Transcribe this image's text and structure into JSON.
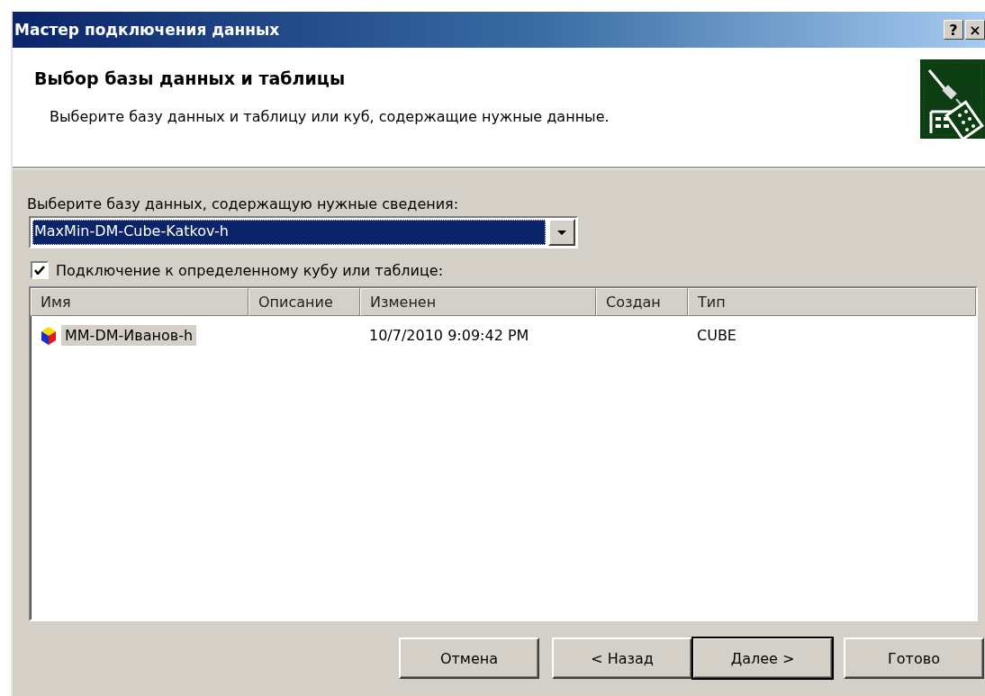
{
  "window": {
    "title": "Мастер подключения данных",
    "controls": [
      "?",
      "×"
    ]
  },
  "header": {
    "title": "Выбор базы данных и таблицы",
    "subtitle": "Выберите базу данных и таблицу или куб, содержащие нужные данные."
  },
  "database": {
    "label": "Выберите базу данных, содержащую нужные сведения:",
    "value": "MaxMin-DM-Cube-Katkov-h"
  },
  "specific": {
    "label": "Подключение к определенному кубу или таблице:",
    "checked": true
  },
  "table": {
    "columns": [
      "Имя",
      "Описание",
      "Изменен",
      "Создан",
      "Тип"
    ],
    "rows": [
      {
        "selected": true,
        "cells": [
          "MM-DM-Иванов-h",
          "",
          "10/7/2010 9:09:42 PM",
          "",
          "CUBE"
        ]
      }
    ]
  },
  "buttons": [
    {
      "label": "Отмена",
      "default": false
    },
    {
      "label": "< Назад",
      "default": false
    },
    {
      "label": "Далее >",
      "default": true
    },
    {
      "label": "Готово",
      "default": false
    }
  ]
}
